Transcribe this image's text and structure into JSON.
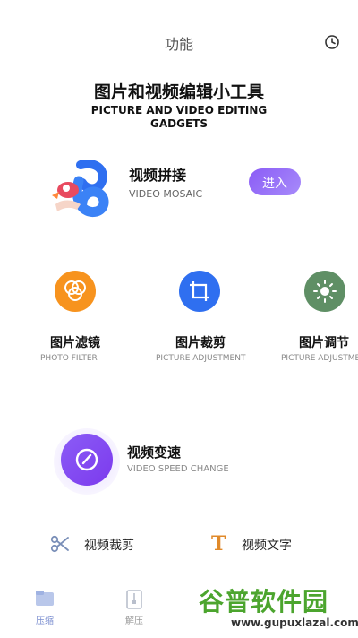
{
  "header": {
    "title": "功能",
    "history_icon": "clock-icon"
  },
  "hero": {
    "title": "图片和视频编辑小工具",
    "subtitle_line1": "PICTURE AND VIDEO EDITING",
    "subtitle_line2": "GADGETS"
  },
  "featured": {
    "title": "视频拼接",
    "subtitle": "VIDEO MOSAIC",
    "button_label": "进入",
    "accent": "#8b5cf6"
  },
  "tools": [
    {
      "title": "图片滤镜",
      "subtitle": "PHOTO FILTER",
      "icon": "filter-icon",
      "color": "#f7931e"
    },
    {
      "title": "图片裁剪",
      "subtitle": "PICTURE ADJUSTMENT",
      "icon": "crop-icon",
      "color": "#2f6ff0"
    },
    {
      "title": "图片调节",
      "subtitle": "PICTURE ADJUSTMENT",
      "icon": "sun-icon",
      "color": "#5f8f65"
    }
  ],
  "speed": {
    "title": "视频变速",
    "subtitle": "VIDEO SPEED CHANGE",
    "icon": "speedometer-icon"
  },
  "small_tools": [
    {
      "label": "视频裁剪",
      "icon": "scissors-icon"
    },
    {
      "label": "视频文字",
      "icon": "text-icon",
      "glyph": "T"
    }
  ],
  "tabs": [
    {
      "label": "压缩",
      "icon": "folder-icon"
    },
    {
      "label": "解压",
      "icon": "zip-icon"
    }
  ],
  "watermark": {
    "big": "谷普软件园",
    "small": "www.gupuxlazal.com"
  }
}
